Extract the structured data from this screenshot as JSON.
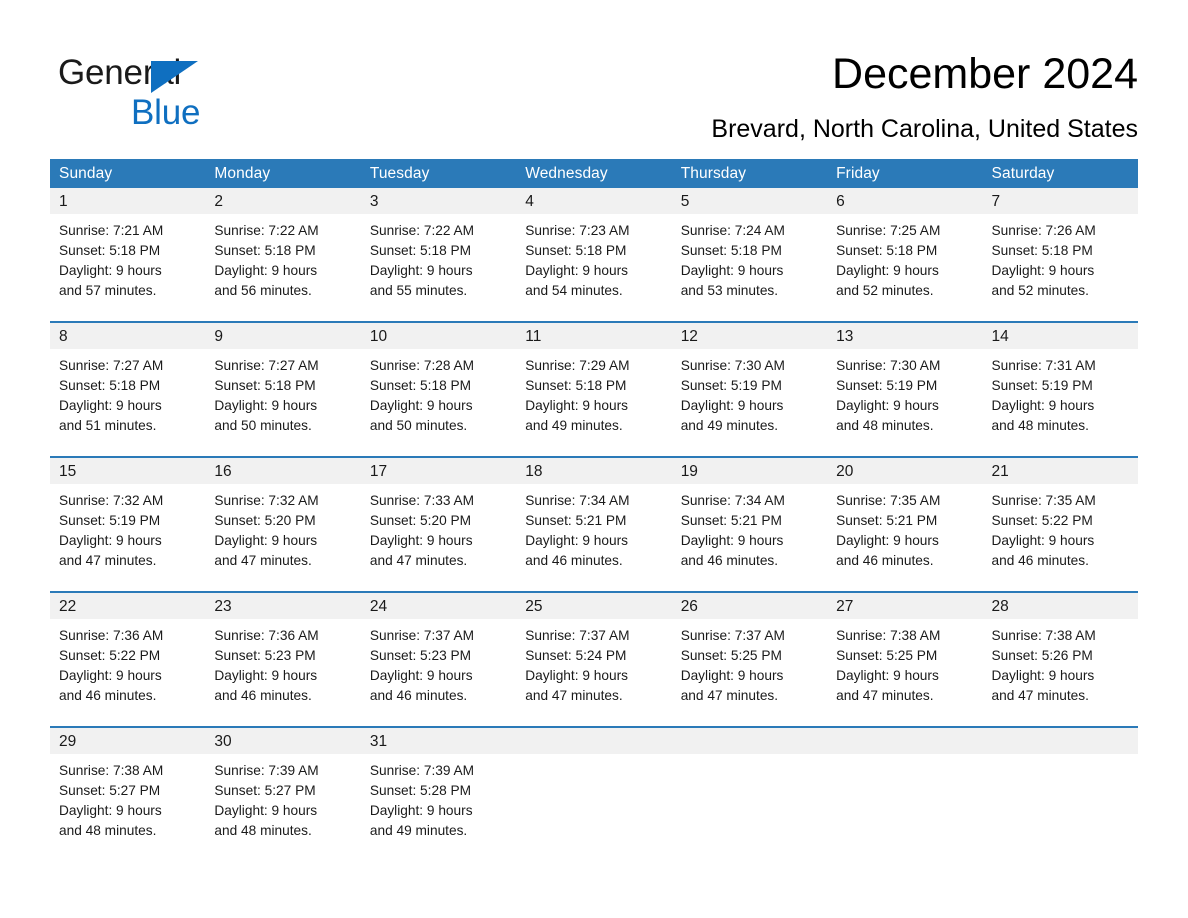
{
  "brand": {
    "name_part1": "General",
    "name_part2": "Blue",
    "logo_icon": "triangle-logo-icon",
    "accent_color": "#0f6fc0"
  },
  "header": {
    "title": "December 2024",
    "subtitle": "Brevard, North Carolina, United States"
  },
  "calendar": {
    "header_bg": "#2b7ab8",
    "day_band_bg": "#f1f1f1",
    "weekdays": [
      "Sunday",
      "Monday",
      "Tuesday",
      "Wednesday",
      "Thursday",
      "Friday",
      "Saturday"
    ],
    "weeks": [
      [
        {
          "day": "1",
          "sunrise": "Sunrise: 7:21 AM",
          "sunset": "Sunset: 5:18 PM",
          "daylight_line1": "Daylight: 9 hours",
          "daylight_line2": "and 57 minutes."
        },
        {
          "day": "2",
          "sunrise": "Sunrise: 7:22 AM",
          "sunset": "Sunset: 5:18 PM",
          "daylight_line1": "Daylight: 9 hours",
          "daylight_line2": "and 56 minutes."
        },
        {
          "day": "3",
          "sunrise": "Sunrise: 7:22 AM",
          "sunset": "Sunset: 5:18 PM",
          "daylight_line1": "Daylight: 9 hours",
          "daylight_line2": "and 55 minutes."
        },
        {
          "day": "4",
          "sunrise": "Sunrise: 7:23 AM",
          "sunset": "Sunset: 5:18 PM",
          "daylight_line1": "Daylight: 9 hours",
          "daylight_line2": "and 54 minutes."
        },
        {
          "day": "5",
          "sunrise": "Sunrise: 7:24 AM",
          "sunset": "Sunset: 5:18 PM",
          "daylight_line1": "Daylight: 9 hours",
          "daylight_line2": "and 53 minutes."
        },
        {
          "day": "6",
          "sunrise": "Sunrise: 7:25 AM",
          "sunset": "Sunset: 5:18 PM",
          "daylight_line1": "Daylight: 9 hours",
          "daylight_line2": "and 52 minutes."
        },
        {
          "day": "7",
          "sunrise": "Sunrise: 7:26 AM",
          "sunset": "Sunset: 5:18 PM",
          "daylight_line1": "Daylight: 9 hours",
          "daylight_line2": "and 52 minutes."
        }
      ],
      [
        {
          "day": "8",
          "sunrise": "Sunrise: 7:27 AM",
          "sunset": "Sunset: 5:18 PM",
          "daylight_line1": "Daylight: 9 hours",
          "daylight_line2": "and 51 minutes."
        },
        {
          "day": "9",
          "sunrise": "Sunrise: 7:27 AM",
          "sunset": "Sunset: 5:18 PM",
          "daylight_line1": "Daylight: 9 hours",
          "daylight_line2": "and 50 minutes."
        },
        {
          "day": "10",
          "sunrise": "Sunrise: 7:28 AM",
          "sunset": "Sunset: 5:18 PM",
          "daylight_line1": "Daylight: 9 hours",
          "daylight_line2": "and 50 minutes."
        },
        {
          "day": "11",
          "sunrise": "Sunrise: 7:29 AM",
          "sunset": "Sunset: 5:18 PM",
          "daylight_line1": "Daylight: 9 hours",
          "daylight_line2": "and 49 minutes."
        },
        {
          "day": "12",
          "sunrise": "Sunrise: 7:30 AM",
          "sunset": "Sunset: 5:19 PM",
          "daylight_line1": "Daylight: 9 hours",
          "daylight_line2": "and 49 minutes."
        },
        {
          "day": "13",
          "sunrise": "Sunrise: 7:30 AM",
          "sunset": "Sunset: 5:19 PM",
          "daylight_line1": "Daylight: 9 hours",
          "daylight_line2": "and 48 minutes."
        },
        {
          "day": "14",
          "sunrise": "Sunrise: 7:31 AM",
          "sunset": "Sunset: 5:19 PM",
          "daylight_line1": "Daylight: 9 hours",
          "daylight_line2": "and 48 minutes."
        }
      ],
      [
        {
          "day": "15",
          "sunrise": "Sunrise: 7:32 AM",
          "sunset": "Sunset: 5:19 PM",
          "daylight_line1": "Daylight: 9 hours",
          "daylight_line2": "and 47 minutes."
        },
        {
          "day": "16",
          "sunrise": "Sunrise: 7:32 AM",
          "sunset": "Sunset: 5:20 PM",
          "daylight_line1": "Daylight: 9 hours",
          "daylight_line2": "and 47 minutes."
        },
        {
          "day": "17",
          "sunrise": "Sunrise: 7:33 AM",
          "sunset": "Sunset: 5:20 PM",
          "daylight_line1": "Daylight: 9 hours",
          "daylight_line2": "and 47 minutes."
        },
        {
          "day": "18",
          "sunrise": "Sunrise: 7:34 AM",
          "sunset": "Sunset: 5:21 PM",
          "daylight_line1": "Daylight: 9 hours",
          "daylight_line2": "and 46 minutes."
        },
        {
          "day": "19",
          "sunrise": "Sunrise: 7:34 AM",
          "sunset": "Sunset: 5:21 PM",
          "daylight_line1": "Daylight: 9 hours",
          "daylight_line2": "and 46 minutes."
        },
        {
          "day": "20",
          "sunrise": "Sunrise: 7:35 AM",
          "sunset": "Sunset: 5:21 PM",
          "daylight_line1": "Daylight: 9 hours",
          "daylight_line2": "and 46 minutes."
        },
        {
          "day": "21",
          "sunrise": "Sunrise: 7:35 AM",
          "sunset": "Sunset: 5:22 PM",
          "daylight_line1": "Daylight: 9 hours",
          "daylight_line2": "and 46 minutes."
        }
      ],
      [
        {
          "day": "22",
          "sunrise": "Sunrise: 7:36 AM",
          "sunset": "Sunset: 5:22 PM",
          "daylight_line1": "Daylight: 9 hours",
          "daylight_line2": "and 46 minutes."
        },
        {
          "day": "23",
          "sunrise": "Sunrise: 7:36 AM",
          "sunset": "Sunset: 5:23 PM",
          "daylight_line1": "Daylight: 9 hours",
          "daylight_line2": "and 46 minutes."
        },
        {
          "day": "24",
          "sunrise": "Sunrise: 7:37 AM",
          "sunset": "Sunset: 5:23 PM",
          "daylight_line1": "Daylight: 9 hours",
          "daylight_line2": "and 46 minutes."
        },
        {
          "day": "25",
          "sunrise": "Sunrise: 7:37 AM",
          "sunset": "Sunset: 5:24 PM",
          "daylight_line1": "Daylight: 9 hours",
          "daylight_line2": "and 47 minutes."
        },
        {
          "day": "26",
          "sunrise": "Sunrise: 7:37 AM",
          "sunset": "Sunset: 5:25 PM",
          "daylight_line1": "Daylight: 9 hours",
          "daylight_line2": "and 47 minutes."
        },
        {
          "day": "27",
          "sunrise": "Sunrise: 7:38 AM",
          "sunset": "Sunset: 5:25 PM",
          "daylight_line1": "Daylight: 9 hours",
          "daylight_line2": "and 47 minutes."
        },
        {
          "day": "28",
          "sunrise": "Sunrise: 7:38 AM",
          "sunset": "Sunset: 5:26 PM",
          "daylight_line1": "Daylight: 9 hours",
          "daylight_line2": "and 47 minutes."
        }
      ],
      [
        {
          "day": "29",
          "sunrise": "Sunrise: 7:38 AM",
          "sunset": "Sunset: 5:27 PM",
          "daylight_line1": "Daylight: 9 hours",
          "daylight_line2": "and 48 minutes."
        },
        {
          "day": "30",
          "sunrise": "Sunrise: 7:39 AM",
          "sunset": "Sunset: 5:27 PM",
          "daylight_line1": "Daylight: 9 hours",
          "daylight_line2": "and 48 minutes."
        },
        {
          "day": "31",
          "sunrise": "Sunrise: 7:39 AM",
          "sunset": "Sunset: 5:28 PM",
          "daylight_line1": "Daylight: 9 hours",
          "daylight_line2": "and 49 minutes."
        },
        {
          "day": "",
          "sunrise": "",
          "sunset": "",
          "daylight_line1": "",
          "daylight_line2": ""
        },
        {
          "day": "",
          "sunrise": "",
          "sunset": "",
          "daylight_line1": "",
          "daylight_line2": ""
        },
        {
          "day": "",
          "sunrise": "",
          "sunset": "",
          "daylight_line1": "",
          "daylight_line2": ""
        },
        {
          "day": "",
          "sunrise": "",
          "sunset": "",
          "daylight_line1": "",
          "daylight_line2": ""
        }
      ]
    ]
  }
}
